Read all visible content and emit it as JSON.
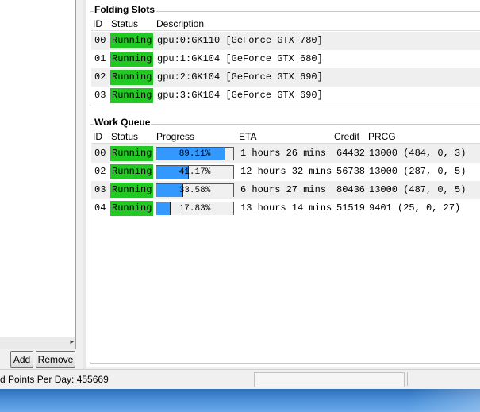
{
  "left": {
    "add_label": "Add",
    "remove_label": "Remove",
    "hscroll_arrow": "▸"
  },
  "slots": {
    "title": "Folding Slots",
    "headers": {
      "id": "ID",
      "status": "Status",
      "description": "Description"
    },
    "rows": [
      {
        "id": "00",
        "status": "Running",
        "description": "gpu:0:GK110 [GeForce GTX 780]"
      },
      {
        "id": "01",
        "status": "Running",
        "description": "gpu:1:GK104 [GeForce GTX 680]"
      },
      {
        "id": "02",
        "status": "Running",
        "description": "gpu:2:GK104 [GeForce GTX 690]"
      },
      {
        "id": "03",
        "status": "Running",
        "description": "gpu:3:GK104 [GeForce GTX 690]"
      }
    ]
  },
  "queue": {
    "title": "Work Queue",
    "headers": {
      "id": "ID",
      "status": "Status",
      "progress": "Progress",
      "eta": "ETA",
      "credit": "Credit",
      "prcg": "PRCG"
    },
    "rows": [
      {
        "id": "00",
        "status": "Running",
        "progress": "89.11%",
        "progress_value": 0.8911,
        "eta": "1 hours 26 mins",
        "credit": "64432",
        "prcg": "13000 (484, 0, 3)"
      },
      {
        "id": "02",
        "status": "Running",
        "progress": "41.17%",
        "progress_value": 0.4117,
        "eta": "12 hours 32 mins",
        "credit": "56738",
        "prcg": "13000 (287, 0, 5)"
      },
      {
        "id": "03",
        "status": "Running",
        "progress": "33.58%",
        "progress_value": 0.3358,
        "eta": "6 hours 27 mins",
        "credit": "80436",
        "prcg": "13000 (487, 0, 5)"
      },
      {
        "id": "04",
        "status": "Running",
        "progress": "17.83%",
        "progress_value": 0.1783,
        "eta": "13 hours 14 mins",
        "credit": "51519",
        "prcg": "9401 (25, 0, 27)"
      }
    ]
  },
  "statusbar": {
    "points_per_day": "d Points Per Day: 455669"
  },
  "colors": {
    "running": "#22c922",
    "progress": "#3399ff"
  }
}
